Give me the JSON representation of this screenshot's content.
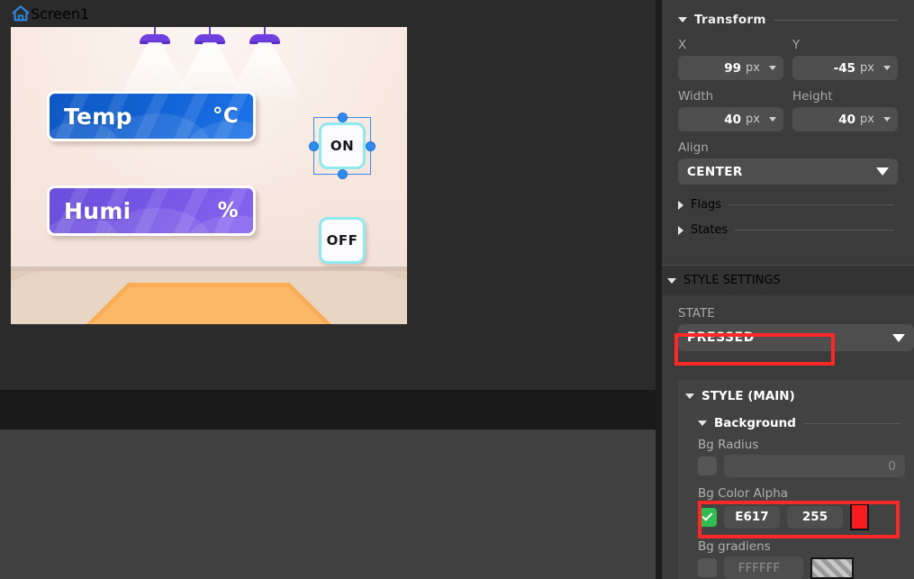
{
  "editor": {
    "screen_tab": {
      "icon": "home-icon",
      "label": "Screen1"
    }
  },
  "canvas": {
    "cards": [
      {
        "label": "Temp",
        "unit": "°C",
        "color": "#1161d2"
      },
      {
        "label": "Humi",
        "unit": "%",
        "color": "#7555e4"
      }
    ],
    "buttons": [
      {
        "label": "ON",
        "selected": true
      },
      {
        "label": "OFF",
        "selected": false
      }
    ]
  },
  "transform": {
    "title": "Transform",
    "x": {
      "label": "X",
      "value": "99",
      "unit": "px"
    },
    "y": {
      "label": "Y",
      "value": "-45",
      "unit": "px"
    },
    "width": {
      "label": "Width",
      "value": "40",
      "unit": "px"
    },
    "height": {
      "label": "Height",
      "value": "40",
      "unit": "px"
    },
    "align": {
      "label": "Align",
      "value": "CENTER"
    },
    "flags": "Flags",
    "states": "States"
  },
  "style_settings": {
    "title": "STYLE SETTINGS",
    "state": {
      "label": "STATE",
      "value": "PRESSED"
    },
    "style_main": {
      "title": "STYLE (MAIN)",
      "background": {
        "title": "Background",
        "bg_radius": {
          "label": "Bg Radius",
          "value": "0",
          "checked": false
        },
        "bg_color_alpha": {
          "label": "Bg Color  Alpha",
          "hex": "E617",
          "alpha": "255",
          "checked": true,
          "swatch_color": "#f51d20"
        },
        "bg_gradiens": {
          "label": "Bg gradiens",
          "hex": "FFFFFF",
          "checked": false
        }
      }
    }
  },
  "colors": {
    "highlight": "#fc2828",
    "panel_bg": "#3b3b3b",
    "field_bg": "#4e4e4e",
    "check_green": "#2fbd4f",
    "selection_blue": "#2f8bf0"
  }
}
